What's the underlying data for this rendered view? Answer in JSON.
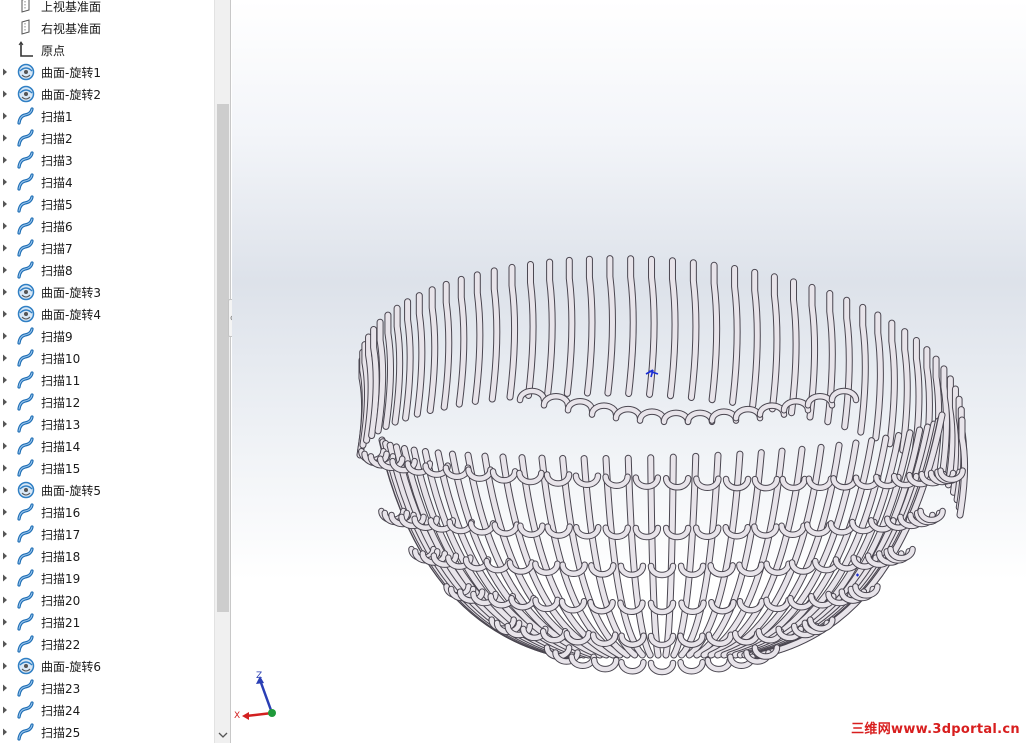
{
  "feature_tree": {
    "items": [
      {
        "label": "上视基准面",
        "icon": "plane-icon",
        "expandable": false
      },
      {
        "label": "右视基准面",
        "icon": "plane-icon",
        "expandable": false
      },
      {
        "label": "原点",
        "icon": "origin-icon",
        "expandable": false
      },
      {
        "label": "曲面-旋转1",
        "icon": "revolve-surface-icon",
        "expandable": true
      },
      {
        "label": "曲面-旋转2",
        "icon": "revolve-surface-icon",
        "expandable": true
      },
      {
        "label": "扫描1",
        "icon": "sweep-icon",
        "expandable": true
      },
      {
        "label": "扫描2",
        "icon": "sweep-icon",
        "expandable": true
      },
      {
        "label": "扫描3",
        "icon": "sweep-icon",
        "expandable": true
      },
      {
        "label": "扫描4",
        "icon": "sweep-icon",
        "expandable": true
      },
      {
        "label": "扫描5",
        "icon": "sweep-icon",
        "expandable": true
      },
      {
        "label": "扫描6",
        "icon": "sweep-icon",
        "expandable": true
      },
      {
        "label": "扫描7",
        "icon": "sweep-icon",
        "expandable": true
      },
      {
        "label": "扫描8",
        "icon": "sweep-icon",
        "expandable": true
      },
      {
        "label": "曲面-旋转3",
        "icon": "revolve-surface-icon",
        "expandable": true
      },
      {
        "label": "曲面-旋转4",
        "icon": "revolve-surface-icon",
        "expandable": true
      },
      {
        "label": "扫描9",
        "icon": "sweep-icon",
        "expandable": true
      },
      {
        "label": "扫描10",
        "icon": "sweep-icon",
        "expandable": true
      },
      {
        "label": "扫描11",
        "icon": "sweep-icon",
        "expandable": true
      },
      {
        "label": "扫描12",
        "icon": "sweep-icon",
        "expandable": true
      },
      {
        "label": "扫描13",
        "icon": "sweep-icon",
        "expandable": true
      },
      {
        "label": "扫描14",
        "icon": "sweep-icon",
        "expandable": true
      },
      {
        "label": "扫描15",
        "icon": "sweep-icon",
        "expandable": true
      },
      {
        "label": "曲面-旋转5",
        "icon": "revolve-surface-icon",
        "expandable": true
      },
      {
        "label": "扫描16",
        "icon": "sweep-icon",
        "expandable": true
      },
      {
        "label": "扫描17",
        "icon": "sweep-icon",
        "expandable": true
      },
      {
        "label": "扫描18",
        "icon": "sweep-icon",
        "expandable": true
      },
      {
        "label": "扫描19",
        "icon": "sweep-icon",
        "expandable": true
      },
      {
        "label": "扫描20",
        "icon": "sweep-icon",
        "expandable": true
      },
      {
        "label": "扫描21",
        "icon": "sweep-icon",
        "expandable": true
      },
      {
        "label": "扫描22",
        "icon": "sweep-icon",
        "expandable": true
      },
      {
        "label": "曲面-旋转6",
        "icon": "revolve-surface-icon",
        "expandable": true
      },
      {
        "label": "扫描23",
        "icon": "sweep-icon",
        "expandable": true
      },
      {
        "label": "扫描24",
        "icon": "sweep-icon",
        "expandable": true
      },
      {
        "label": "扫描25",
        "icon": "sweep-icon",
        "expandable": true
      }
    ]
  },
  "triad": {
    "x_label": "X",
    "z_label": "Z"
  },
  "watermark": "三维网www.3dportal.cn",
  "colors": {
    "sweep_icon": "#1f6fb5",
    "revolve_icon": "#2f7fc4",
    "x_axis": "#d22020",
    "y_axis": "#1f9a3a",
    "z_axis": "#2a3fb5",
    "model_metal": "#e8e4ea",
    "model_edge": "#4a4650",
    "watermark": "#d81e1e"
  }
}
